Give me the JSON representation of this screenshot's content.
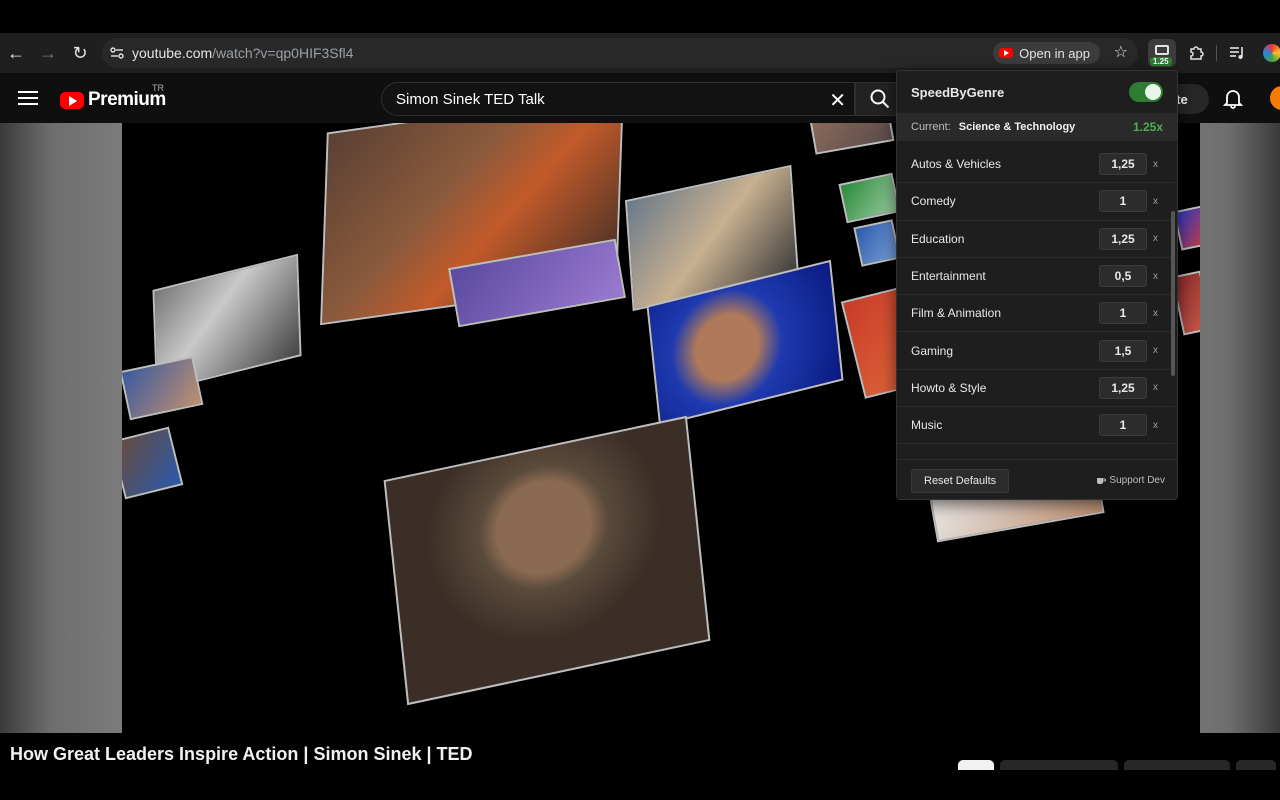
{
  "browser": {
    "url_host": "youtube.com",
    "url_path": "/watch?v=qp0HIF3Sfl4",
    "open_in_app_label": "Open in app",
    "extension_badge": "1.25"
  },
  "youtube": {
    "logo_word": "Premium",
    "region": "TR",
    "search_value": "Simon Sinek TED Talk",
    "create_label": "ate",
    "video_title": "How Great Leaders Inspire Action | Simon Sinek | TED"
  },
  "extension_popup": {
    "title": "SpeedByGenre",
    "enabled": true,
    "current_label": "Current:",
    "current_category": "Science & Technology",
    "current_speed": "1.25x",
    "multiplier_symbol": "x",
    "genres": [
      {
        "name": "Autos & Vehicles",
        "speed": "1,25"
      },
      {
        "name": "Comedy",
        "speed": "1"
      },
      {
        "name": "Education",
        "speed": "1,25"
      },
      {
        "name": "Entertainment",
        "speed": "0,5"
      },
      {
        "name": "Film & Animation",
        "speed": "1"
      },
      {
        "name": "Gaming",
        "speed": "1,5"
      },
      {
        "name": "Howto & Style",
        "speed": "1,25"
      },
      {
        "name": "Music",
        "speed": "1"
      }
    ],
    "reset_label": "Reset Defaults",
    "support_label": "Support Dev"
  },
  "colors": {
    "accent_green": "#4caf50",
    "toggle_green": "#2e7d32",
    "youtube_red": "#ff0000"
  }
}
